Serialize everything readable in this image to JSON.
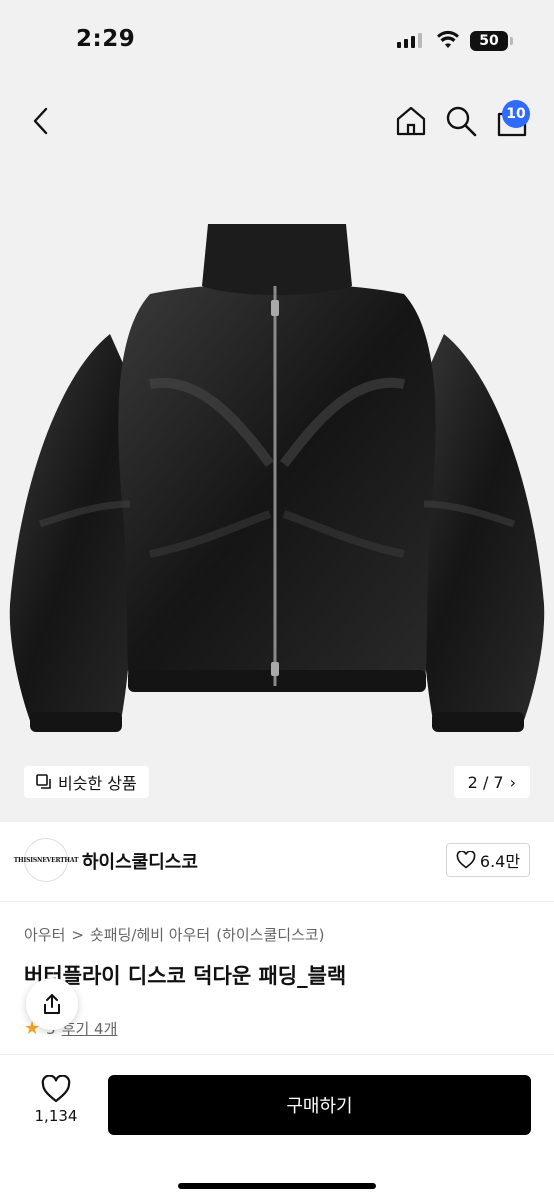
{
  "status_bar": {
    "time": "2:29",
    "battery": "50"
  },
  "nav": {
    "cart_count": "10"
  },
  "gallery": {
    "similar_label": "비슷한 상품",
    "page_indicator": "2 / 7",
    "chevron": "›"
  },
  "brand": {
    "logo_text": "THISISNEVERTHAT",
    "name": "하이스쿨디스코",
    "likes": "6.4만"
  },
  "breadcrumb": [
    "아우터",
    "숏패딩/헤비 아우터",
    "(하이스쿨디스코)"
  ],
  "breadcrumb_sep": ">",
  "product": {
    "title": "버터플라이 디스코 덕다운 패딩_블랙",
    "rating": "5",
    "reviews": "후기 4개"
  },
  "bottom": {
    "wish_count": "1,134",
    "buy_label": "구매하기"
  },
  "colors": {
    "accent": "#2f6bff",
    "star": "#f5a623",
    "button": "#000000"
  }
}
